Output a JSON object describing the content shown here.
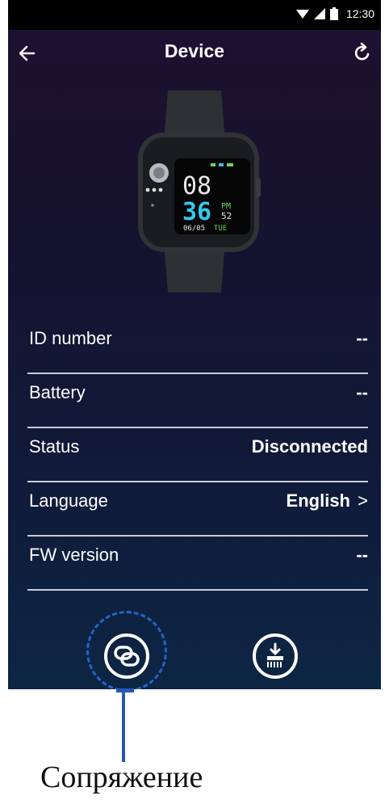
{
  "status_bar": {
    "time": "12:30"
  },
  "header": {
    "title": "Device",
    "back_icon": "arrow-left-icon",
    "refresh_icon": "refresh-icon"
  },
  "watch_face": {
    "hour": "08",
    "minute": "36",
    "ampm": "PM",
    "seconds": "52",
    "date": "06/05",
    "weekday": "TUE"
  },
  "info_rows": [
    {
      "label": "ID number",
      "value": "--"
    },
    {
      "label": "Battery",
      "value": "--"
    },
    {
      "label": "Status",
      "value": "Disconnected"
    },
    {
      "label": "Language",
      "value": "English",
      "chevron": ">"
    },
    {
      "label": "FW version",
      "value": "--"
    }
  ],
  "actions": {
    "pair_icon": "link-icon",
    "reset_icon": "download-reset-icon"
  },
  "annotation": {
    "caption": "Сопряжение",
    "color": "#2857b8"
  },
  "colors": {
    "background_top": "#1e1130",
    "background_bottom": "#0d2644",
    "accent_green": "#6fd35a"
  }
}
